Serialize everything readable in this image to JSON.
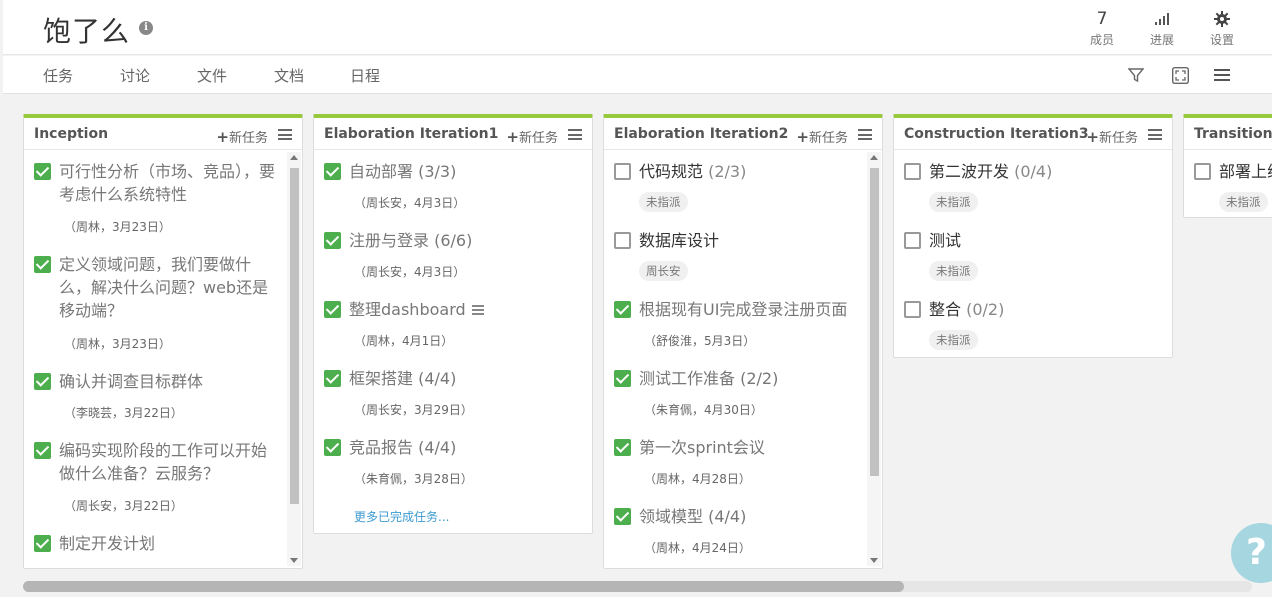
{
  "project": {
    "title": "饱了么"
  },
  "toolbar": {
    "members_count": "7",
    "members_label": "成员",
    "progress_label": "进展",
    "settings_label": "设置"
  },
  "nav": {
    "tabs": [
      "任务",
      "讨论",
      "文件",
      "文档",
      "日程"
    ]
  },
  "colors": {
    "accent": "#97c93d",
    "checked": "#4cae4c",
    "link": "#3d9ad1"
  },
  "columns": [
    {
      "title": "Inception",
      "add_label": "新任务",
      "tasks": [
        {
          "title": "可行性分析（市场、竞品），要考虑什么系统特性",
          "meta": "（周林，3月23日）",
          "done": true
        },
        {
          "title": "定义领域问题，我们要做什么，解决什么问题？web还是移动端？",
          "meta": "（周林，3月23日）",
          "done": true
        },
        {
          "title": "确认并调查目标群体",
          "meta": "（李晓芸，3月22日）",
          "done": true
        },
        {
          "title": "编码实现阶段的工作可以开始做什么准备？云服务？",
          "meta": "（周长安，3月22日）",
          "done": true
        },
        {
          "title": "制定开发计划",
          "done": true
        }
      ]
    },
    {
      "title": "Elaboration Iteration1",
      "add_label": "新任务",
      "tasks": [
        {
          "title": "自动部署",
          "count": "(3/3)",
          "meta": "（周长安，4月3日）",
          "done": true
        },
        {
          "title": "注册与登录",
          "count": "(6/6)",
          "meta": "（周长安，4月3日）",
          "done": true
        },
        {
          "title": "整理dashboard",
          "meta": "（周林，4月1日）",
          "done": true
        },
        {
          "title": "框架搭建",
          "count": "(4/4)",
          "meta": "（周长安，3月29日）",
          "done": true
        },
        {
          "title": "竞品报告",
          "count": "(4/4)",
          "meta": "（朱育佩，3月28日）",
          "done": true
        }
      ],
      "more_label": "更多已完成任务..."
    },
    {
      "title": "Elaboration Iteration2",
      "add_label": "新任务",
      "tasks": [
        {
          "title": "代码规范",
          "count": "(2/3)",
          "pill": "未指派",
          "done": false
        },
        {
          "title": "数据库设计",
          "pill": "周长安",
          "done": false
        },
        {
          "title": "根据现有UI完成登录注册页面",
          "meta": "（舒俊淮，5月3日）",
          "done": true
        },
        {
          "title": "测试工作准备",
          "count": "(2/2)",
          "meta": "（朱育佩，4月30日）",
          "done": true
        },
        {
          "title": "第一次sprint会议",
          "meta": "（周林，4月28日）",
          "done": true
        },
        {
          "title": "领域模型",
          "count": "(4/4)",
          "meta": "（周林，4月24日）",
          "done": true
        }
      ]
    },
    {
      "title": "Construction Iteration3",
      "add_label": "新任务",
      "tasks": [
        {
          "title": "第二波开发",
          "count": "(0/4)",
          "pill": "未指派",
          "done": false
        },
        {
          "title": "测试",
          "pill": "未指派",
          "done": false
        },
        {
          "title": "整合",
          "count": "(0/2)",
          "pill": "未指派",
          "done": false
        }
      ]
    },
    {
      "title": "Transition",
      "tasks": [
        {
          "title": "部署上线",
          "pill": "未指派",
          "done": false
        }
      ]
    }
  ]
}
